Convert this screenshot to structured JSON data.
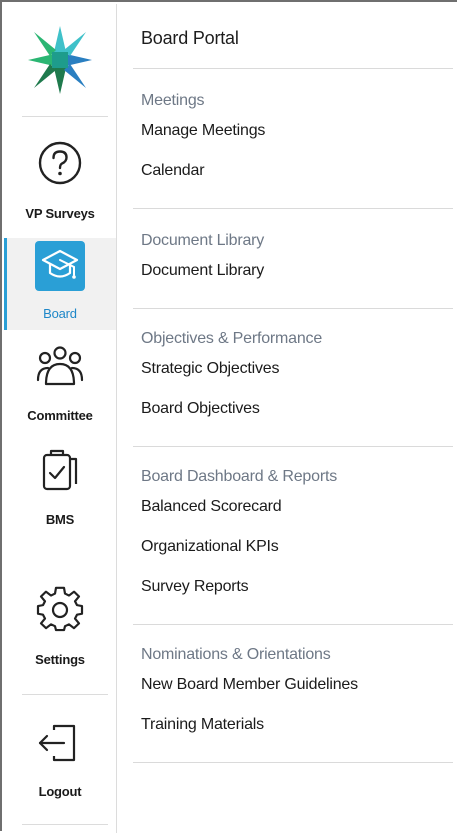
{
  "sidebar": {
    "logo": "star-logo-icon",
    "items": [
      {
        "id": "vp-surveys",
        "label": "VP Surveys",
        "icon": "question-circle-icon"
      },
      {
        "id": "board",
        "label": "Board",
        "icon": "graduation-cap-icon",
        "active": true
      },
      {
        "id": "committee",
        "label": "Committee",
        "icon": "people-group-icon"
      },
      {
        "id": "bms",
        "label": "BMS",
        "icon": "clipboard-check-icon"
      },
      {
        "id": "settings",
        "label": "Settings",
        "icon": "gear-icon"
      },
      {
        "id": "logout",
        "label": "Logout",
        "icon": "logout-icon"
      }
    ]
  },
  "main": {
    "title": "Board Portal",
    "sections": [
      {
        "heading": "Meetings",
        "links": [
          "Manage Meetings",
          "Calendar"
        ]
      },
      {
        "heading": "Document Library",
        "links": [
          "Document Library"
        ]
      },
      {
        "heading": "Objectives & Performance",
        "links": [
          "Strategic Objectives",
          "Board Objectives"
        ]
      },
      {
        "heading": "Board Dashboard & Reports",
        "links": [
          "Balanced Scorecard",
          "Organizational KPIs",
          "Survey Reports"
        ]
      },
      {
        "heading": "Nominations & Orientations",
        "links": [
          "New Board Member Guidelines",
          "Training Materials"
        ]
      }
    ]
  },
  "colors": {
    "accent": "#2a9fd6",
    "logo_green": "#2bb673",
    "logo_dark_green": "#1f7a4d",
    "logo_blue": "#2a7fc1",
    "logo_teal": "#3fc1c9",
    "section_heading": "#6e7886"
  }
}
